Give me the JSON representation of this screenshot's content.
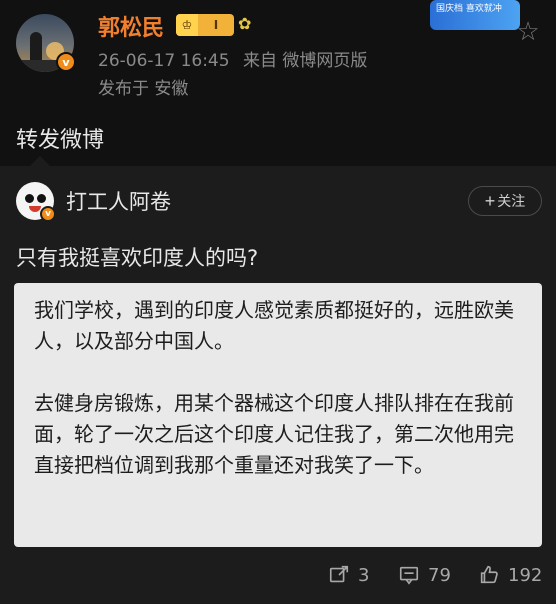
{
  "post": {
    "author": "郭松民",
    "level_badge": "I",
    "timestamp": "26-06-17 16:45",
    "source": "来自 微博网页版",
    "location": "发布于 安徽",
    "promo_text": "国庆档 喜欢就冲"
  },
  "repost_label": "转发微博",
  "original": {
    "author": "打工人阿卷",
    "follow_label": "关注",
    "text": "只有我挺喜欢印度人的吗?",
    "image_paragraphs": [
      "我们学校，遇到的印度人感觉素质都挺好的，远胜欧美人，以及部分中国人。",
      "去健身房锻炼，用某个器械这个印度人排队排在在我前面，轮了一次之后这个印度人记住我了，第二次他用完直接把档位调到我那个重量还对我笑了一下。"
    ]
  },
  "actions": {
    "reposts": "3",
    "comments": "79",
    "likes": "192"
  },
  "colors": {
    "background": "#111111",
    "card": "#1c1c1c",
    "username": "#f07f2e",
    "muted": "#8a8a8a"
  }
}
